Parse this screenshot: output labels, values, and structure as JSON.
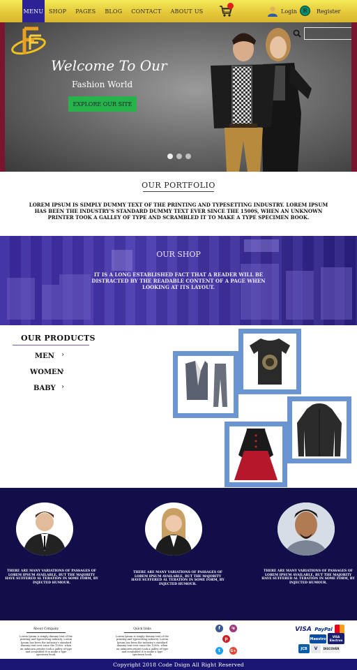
{
  "nav": {
    "menu_label": "MENU",
    "links": [
      "SHOP",
      "PAGES",
      "BLOG",
      "CONTACT",
      "ABOUT US"
    ],
    "login": "Login",
    "register": "Register",
    "cart_icon": "cart-icon",
    "user_icon": "user-icon",
    "register_icon_letter": "R"
  },
  "hero": {
    "logo_letters": "F",
    "welcome": "Welcome To Our",
    "subtitle": "Fashion World",
    "cta": "EXPLORE OUR SITE",
    "search_placeholder": "",
    "slides": 3,
    "active_slide": 1
  },
  "portfolio": {
    "title": "OUR PORTFOLIO",
    "text": "LOREM IPSUM IS SIMPLY DUMMY TEXT OF THE PRINTING AND TYPESETTING INDUSTRY. LOREM IPSUM HAS BEEN THE INDUSTRY'S STANDARD DUMMY TEXT EVER SINCE THE 1500S, WHEN AN UNKNOWN PRINTER TOOK A GALLEY OF TYPE AND SCRAMBLED IT TO MAKE A TYPE SPECIMEN BOOK."
  },
  "shop": {
    "title": "OUR SHOP",
    "text": "IT IS A LONG ESTABLISHED FACT THAT A READER WILL BE DISTRACTED BY THE READABLE CONTENT OF A PAGE WHEN LOOKING AT ITS LAYOUT."
  },
  "products": {
    "title": "OUR PRODUCTS",
    "categories": [
      "MEN",
      "WOMEN",
      "BABY"
    ]
  },
  "team": {
    "text_1": "THERE ARE MANY VARIATIONS OF PASSAGES OF LOREM IPSUM AVAILABLE, BUT THE MAJORITY HAVE SUFFERED AL TERATION IN SOME FORM, BY INJECTED HUMOUR.",
    "text_2": "THERE ARE MANY VARIATIONS OF PASSAGES OF LOREM IPSUM AVAILABLE, BUT THE MAJORITY HAVE SUFFERED AL TERATION IN SOME FORM, BY INJECTED HUMOUR.",
    "text_3": "THERE ARE MANY VARIATIONS OF PASSAGES OF LOREM IPSUM AVAILABLE, BUT THE MAJORITY HAVE SUFFERED AL TERATION IN SOME FORM, BY INJECTED HUMOUR."
  },
  "footer": {
    "about_title": "About Company",
    "about_text": "Lorem Ipsum is simply dummy text of the printing and typesetting industry. Lorem Ipsum has been the industry's standard dummy text ever since the 1500s, when an unknown printer took a galley of type and scrambled it to make a type specimen book.",
    "quick_title": "Quick links",
    "quick_text": "Lorem Ipsum is simply dummy text of the printing and typesetting industry. Lorem Ipsum has been the industry's standard dummy text ever since the 1500s, when an unknown printer took a galley of type and scrambled it to make a type specimen book.",
    "social": [
      "f",
      "ig",
      "p",
      "t",
      "G+"
    ],
    "cards": [
      "VISA",
      "PayPal",
      "Maestro",
      "VISA Electron",
      "JCB",
      "V",
      "DISCOVER"
    ],
    "copyright": "Copyright 2018 Code Dsign All Right Reserved"
  },
  "colors": {
    "nav_gradient_top": "#f3ea5a",
    "menu_active": "#2c2295",
    "cta_green": "#28b34a",
    "shop_overlay": "#3a2aa0",
    "team_bg": "#110e4a",
    "frame_blue": "#6b95d1",
    "copyright_bg": "#1a1572"
  }
}
